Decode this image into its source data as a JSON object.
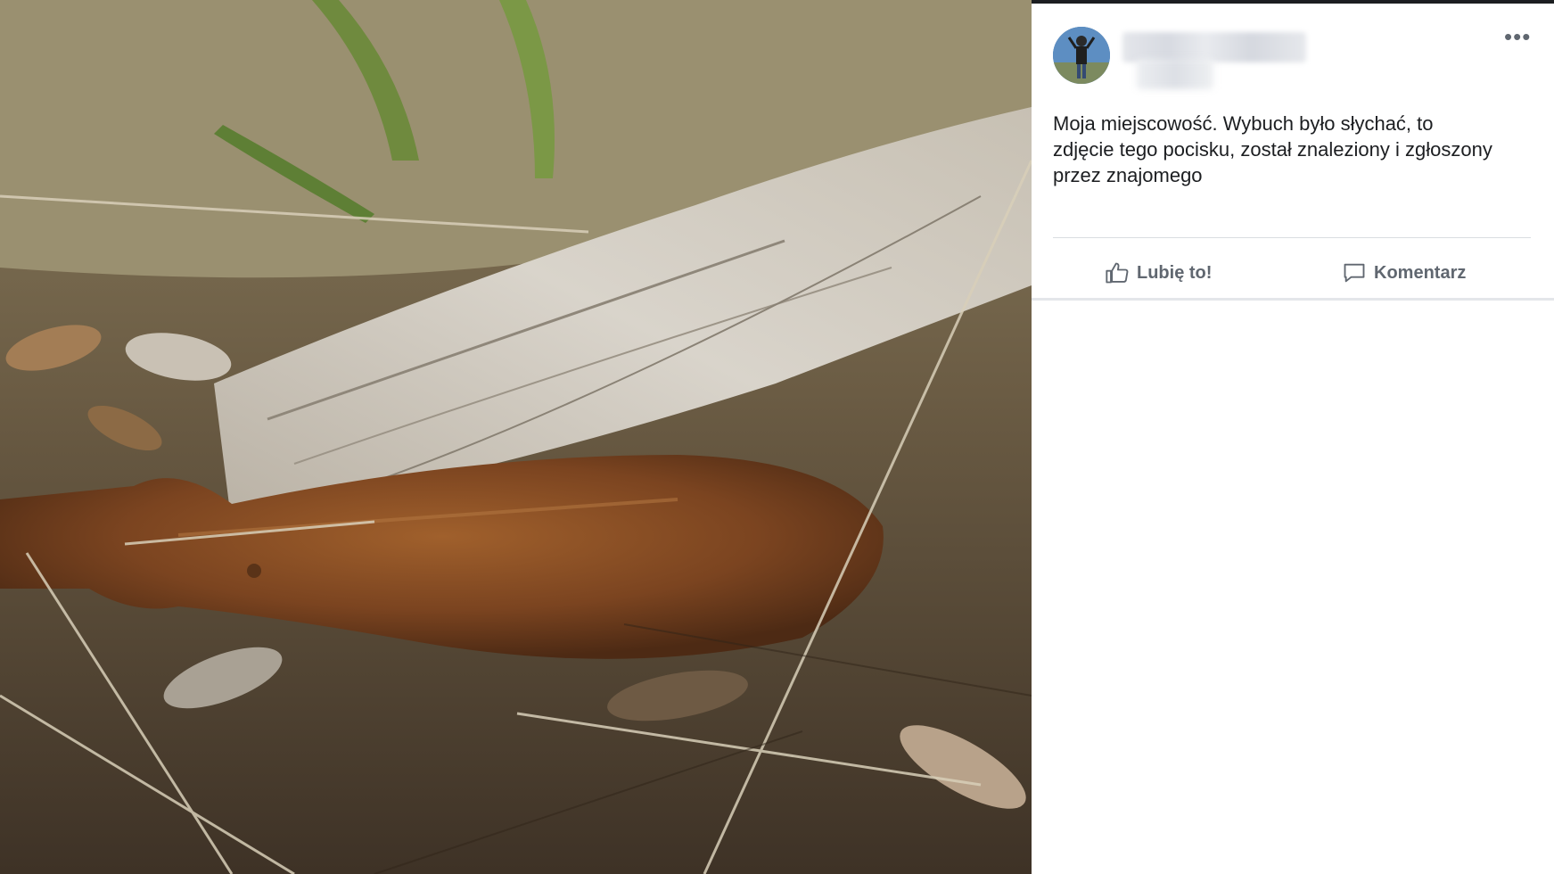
{
  "post": {
    "text": "Moja miejscowość. Wybuch było słychać, to zdjęcie tego pocisku, został znaleziony i zgłoszony przez znajomego",
    "more_icon": "•••",
    "author_name_visible": false
  },
  "actions": {
    "like_label": "Lubię to!",
    "comment_label": "Komentarz"
  },
  "photo": {
    "subject": "rusted mortar shell lying on dry grass next to weathered wood"
  },
  "colors": {
    "text": "#1c1e21",
    "secondary": "#606770",
    "divider": "#dadde1"
  }
}
